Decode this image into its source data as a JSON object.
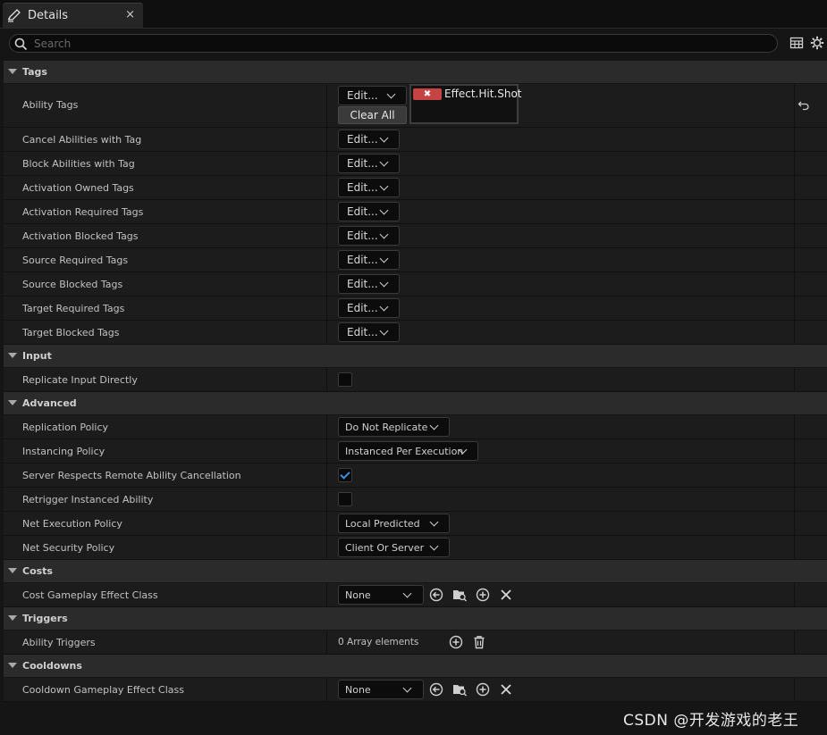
{
  "tab": {
    "title": "Details",
    "close": "×"
  },
  "search": {
    "placeholder": "Search",
    "value": ""
  },
  "categories": {
    "tags": "Tags",
    "input": "Input",
    "advanced": "Advanced",
    "costs": "Costs",
    "triggers": "Triggers",
    "cooldowns": "Cooldowns"
  },
  "tags": {
    "edit_label": "Edit...",
    "clear_all": "Clear All",
    "tag_remove": "✖",
    "ability_tags_value": "Effect.Hit.Shot",
    "rows": [
      "Ability Tags",
      "Cancel Abilities with Tag",
      "Block Abilities with Tag",
      "Activation Owned Tags",
      "Activation Required Tags",
      "Activation Blocked Tags",
      "Source Required Tags",
      "Source Blocked Tags",
      "Target Required Tags",
      "Target Blocked Tags"
    ]
  },
  "input": {
    "replicate_input_directly": {
      "label": "Replicate Input Directly",
      "checked": false
    }
  },
  "advanced": {
    "replication_policy": {
      "label": "Replication Policy",
      "value": "Do Not Replicate"
    },
    "instancing_policy": {
      "label": "Instancing Policy",
      "value": "Instanced Per Execution"
    },
    "server_respects_cancel": {
      "label": "Server Respects Remote Ability Cancellation",
      "checked": true
    },
    "retrigger_instanced": {
      "label": "Retrigger Instanced Ability",
      "checked": false
    },
    "net_execution_policy": {
      "label": "Net Execution Policy",
      "value": "Local Predicted"
    },
    "net_security_policy": {
      "label": "Net Security Policy",
      "value": "Client Or Server"
    }
  },
  "costs": {
    "cost_effect_class": {
      "label": "Cost Gameplay Effect Class",
      "value": "None"
    }
  },
  "triggers": {
    "ability_triggers": {
      "label": "Ability Triggers",
      "value": "0 Array elements"
    }
  },
  "cooldowns": {
    "cooldown_effect_class": {
      "label": "Cooldown Gameplay Effect Class",
      "value": "None"
    }
  },
  "watermark": "CSDN @开发游戏的老王",
  "colors": {
    "accent_check": "#3a8ee0",
    "tag_remove": "#c64343",
    "background": "#151515"
  }
}
